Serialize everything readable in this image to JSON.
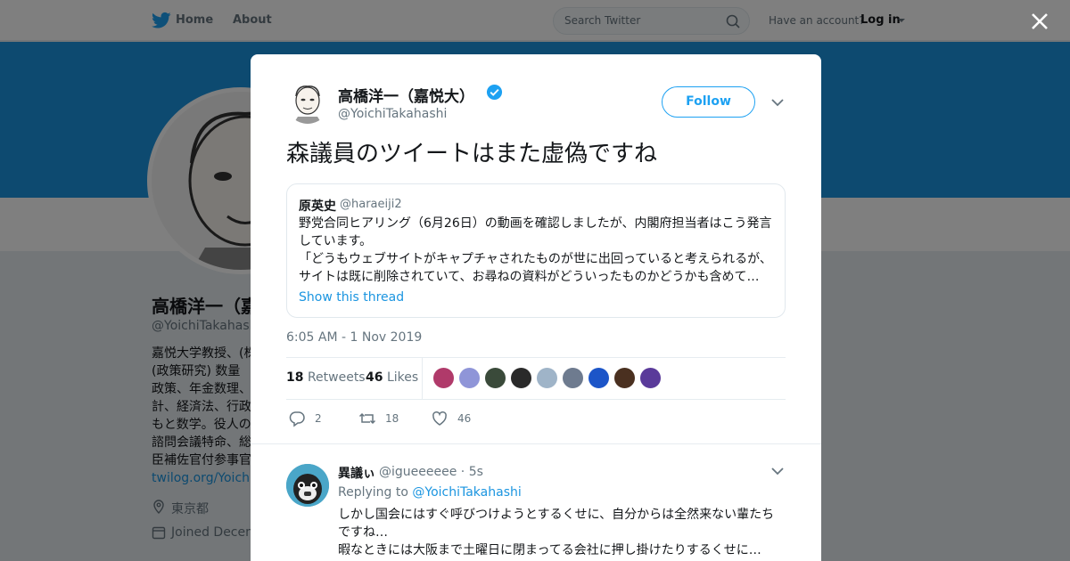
{
  "nav": {
    "home": "Home",
    "about": "About",
    "search_placeholder": "Search Twitter",
    "have_account": "Have an account?",
    "login": "Log in"
  },
  "profile": {
    "name": "高橋洋一（嘉",
    "handle": "@YoichiTakahash",
    "bio": "嘉悦大学教授、(株\n(政策研究) 数量\n政策、年金数理、\n計、経済法、行政\nもと数学。役人の\n諮問会議特命、総\n臣補佐官付参事官",
    "link": "twilog.org/YoichiTa",
    "location": "東京都",
    "joined": "Joined Decem"
  },
  "tweet": {
    "name": "高橋洋一（嘉悦大）",
    "handle": "@YoichiTakahashi",
    "follow_label": "Follow",
    "text": "森議員のツイートはまた虚偽ですね",
    "quote": {
      "name": "原英史",
      "handle": "@haraeiji2",
      "body": "野党合同ヒアリング（6月26日）の動画を確認しましたが、内閣府担当者はこう発言しています。\n「どうもウェブサイトがキャプチャされたものが世に出回っていると考えられるが、サイトは既に削除されていて、お尋ねの資料がどういったものかどうかも含めて…",
      "show_thread": "Show this thread"
    },
    "timestamp": "6:05 AM - 1 Nov 2019",
    "retweets_count": "18",
    "retweets_label": "Retweets",
    "likes_count": "46",
    "likes_label": "Likes",
    "replies_action": "2",
    "retweets_action": "18",
    "likes_action": "46"
  },
  "likers": [
    "#b03a6a",
    "#8f95d8",
    "#3a4a3a",
    "#2a2a2a",
    "#9fb4c8",
    "#6e7b8f",
    "#1c55c8",
    "#4a3020",
    "#5a3a9a"
  ],
  "reply": {
    "name": "異議ぃ",
    "handle": "@igueeeeee",
    "time": "· 5s",
    "replying_prefix": "Replying to",
    "replying_to": "@YoichiTakahashi",
    "body": "しかし国会にはすぐ呼びつけようとするくせに、自分からは全然来ない輩たちですね…\n暇なときには大阪まで土曜日に閉まってる会社に押し掛けたりするくせに…"
  },
  "colors": {
    "brand": "#1da1f2",
    "banner": "#1b95e0",
    "link": "#1b95e0"
  }
}
